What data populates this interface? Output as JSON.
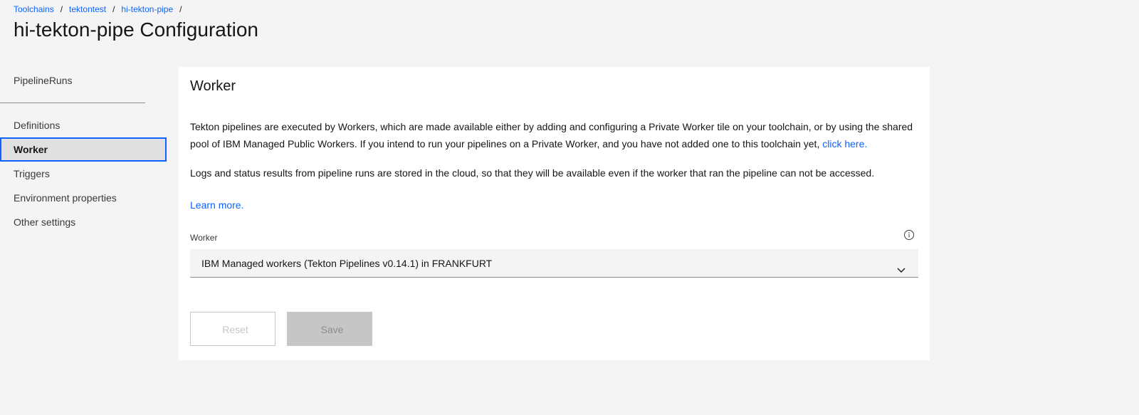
{
  "breadcrumb": {
    "items": [
      "Toolchains",
      "tektontest",
      "hi-tekton-pipe"
    ],
    "separator": "/"
  },
  "page": {
    "title": "hi-tekton-pipe Configuration"
  },
  "sidebar": {
    "items": [
      {
        "label": "PipelineRuns"
      },
      {
        "label": "Definitions"
      },
      {
        "label": "Worker"
      },
      {
        "label": "Triggers"
      },
      {
        "label": "Environment properties"
      },
      {
        "label": "Other settings"
      }
    ],
    "active": "Worker"
  },
  "worker": {
    "title": "Worker",
    "desc1_text": "Tekton pipelines are executed by Workers, which are made available either by adding and configuring a Private Worker tile on your toolchain, or by using the shared pool of IBM Managed Public Workers. If you intend to run your pipelines on a Private Worker, and you have not added one to this toolchain yet,",
    "desc1_link": "click here.",
    "desc2": "Logs and status results from pipeline runs are stored in the cloud, so that they will be available even if the worker that ran the pipeline can not be accessed.",
    "learn_more": "Learn more.",
    "field_label": "Worker",
    "selected": "IBM Managed workers (Tekton Pipelines v0.14.1) in FRANKFURT",
    "reset_label": "Reset",
    "save_label": "Save"
  },
  "colors": {
    "link": "#0f62fe",
    "background": "#f4f4f4",
    "card": "#ffffff"
  },
  "icons": {
    "info": "info-circle-icon",
    "dropdown": "chevron-down-icon"
  }
}
